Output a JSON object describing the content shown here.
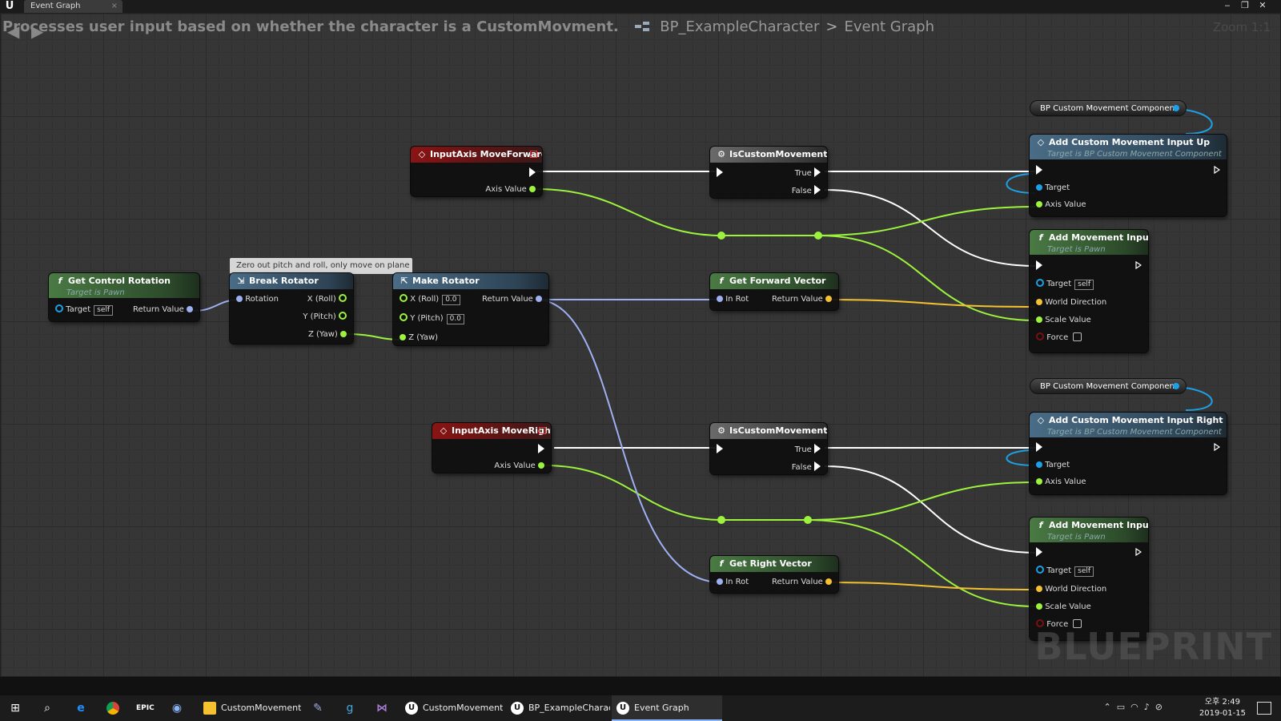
{
  "window": {
    "tab_title": "Event Graph",
    "close_glyph": "×"
  },
  "breadcrumb": {
    "description": "Processes user input based on whether the character is a CustomMovment.",
    "blueprint": "BP_ExampleCharacter",
    "separator": ">",
    "graph": "Event Graph",
    "zoom": "Zoom 1:1"
  },
  "comment": "Zero out pitch and roll, only move on plane",
  "nodes": {
    "get_control_rotation": {
      "title": "Get Control Rotation",
      "subtitle": "Target is Pawn",
      "pin_target": "Target",
      "target_default": "self",
      "pin_return": "Return Value"
    },
    "break_rotator": {
      "title": "Break Rotator",
      "pin_rotation": "Rotation",
      "pin_x": "X (Roll)",
      "pin_y": "Y (Pitch)",
      "pin_z": "Z (Yaw)"
    },
    "make_rotator": {
      "title": "Make Rotator",
      "pin_x": "X (Roll)",
      "x_value": "0.0",
      "pin_y": "Y (Pitch)",
      "y_value": "0.0",
      "pin_z": "Z (Yaw)",
      "pin_return": "Return Value"
    },
    "input_forward": {
      "title": "InputAxis MoveForward",
      "pin_axis": "Axis Value"
    },
    "input_right": {
      "title": "InputAxis MoveRight",
      "pin_axis": "Axis Value"
    },
    "is_custom_1": {
      "title": "IsCustomMovement",
      "pin_true": "True",
      "pin_false": "False"
    },
    "is_custom_2": {
      "title": "IsCustomMovement",
      "pin_true": "True",
      "pin_false": "False"
    },
    "get_forward_vector": {
      "title": "Get Forward Vector",
      "pin_in": "In Rot",
      "pin_return": "Return Value"
    },
    "get_right_vector": {
      "title": "Get Right Vector",
      "pin_in": "In Rot",
      "pin_return": "Return Value"
    },
    "var_comp_1": {
      "label": "BP Custom Movement Component"
    },
    "var_comp_2": {
      "label": "BP Custom Movement Component"
    },
    "add_custom_up": {
      "title": "Add Custom Movement Input Up",
      "subtitle": "Target is BP Custom Movement Component",
      "pin_target": "Target",
      "pin_axis": "Axis Value"
    },
    "add_custom_right": {
      "title": "Add Custom Movement Input Right",
      "subtitle": "Target is BP Custom Movement Component",
      "pin_target": "Target",
      "pin_axis": "Axis Value"
    },
    "add_movement_1": {
      "title": "Add Movement Input",
      "subtitle": "Target is Pawn",
      "pin_target": "Target",
      "target_default": "self",
      "pin_world": "World Direction",
      "pin_scale": "Scale Value",
      "pin_force": "Force"
    },
    "add_movement_2": {
      "title": "Add Movement Input",
      "subtitle": "Target is Pawn",
      "pin_target": "Target",
      "target_default": "self",
      "pin_world": "World Direction",
      "pin_scale": "Scale Value",
      "pin_force": "Force"
    }
  },
  "watermark": "BLUEPRINT",
  "taskbar": {
    "apps": [
      "CustomMovement...",
      "CustomMovement...",
      "BP_ExampleCharac...",
      "Event Graph"
    ],
    "clock_time": "오후 2:49",
    "clock_date": "2019-01-15"
  },
  "colors": {
    "exec": "#ffffff",
    "float": "#9cf23c",
    "vector": "#f5c130",
    "rotator": "#9fb0f2",
    "object": "#1ea0e6"
  }
}
